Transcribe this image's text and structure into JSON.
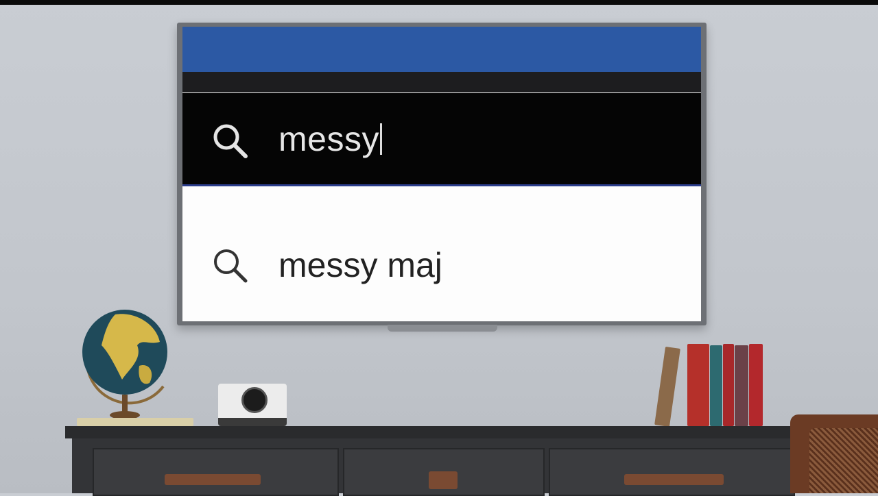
{
  "search": {
    "query": "messy",
    "suggestions": [
      {
        "label": "messy maj",
        "icon": "search-icon"
      }
    ]
  },
  "icons": {
    "search_bar_icon": "search-icon",
    "suggestion_icon": "search-icon"
  },
  "colors": {
    "tv_header_blue": "#2c59a4",
    "search_bar_bg": "#050505",
    "suggestion_bg": "#fdfdfd",
    "wall": "#c5c9cf"
  }
}
